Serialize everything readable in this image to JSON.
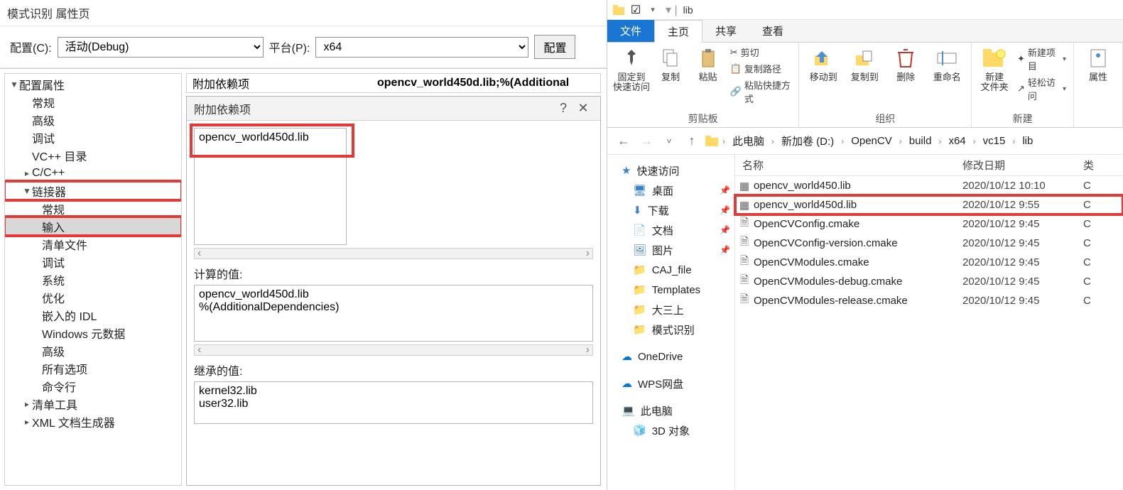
{
  "vs": {
    "title": "模式识别 属性页",
    "config_label": "配置(C):",
    "config_value": "活动(Debug)",
    "platform_label": "平台(P):",
    "platform_value": "x64",
    "mgr_button": "配置",
    "tree": {
      "root": "配置属性",
      "items": [
        "常规",
        "高级",
        "调试",
        "VC++ 目录",
        "C/C++"
      ],
      "linker": "链接器",
      "linker_items": [
        "常规",
        "输入",
        "清单文件",
        "调试",
        "系统",
        "优化",
        "嵌入的 IDL",
        "Windows 元数据",
        "高级",
        "所有选项",
        "命令行"
      ],
      "manifest_tool": "清单工具",
      "xml_gen": "XML 文档生成器"
    },
    "prop_key": "附加依赖项",
    "prop_val": "opencv_world450d.lib;%(Additional",
    "dialog": {
      "title": "附加依赖项",
      "edit_value": "opencv_world450d.lib",
      "calc_label": "计算的值:",
      "calc_value": "opencv_world450d.lib\n%(AdditionalDependencies)",
      "inherit_label": "继承的值:",
      "inherit_value": "kernel32.lib\nuser32.lib"
    }
  },
  "ex": {
    "titlebar": "lib",
    "tabs": {
      "file": "文件",
      "home": "主页",
      "share": "共享",
      "view": "查看"
    },
    "ribbon": {
      "pin": "固定到\n快速访问",
      "copy": "复制",
      "paste": "粘贴",
      "cut": "剪切",
      "copypath": "复制路径",
      "paste_shortcut": "粘贴快捷方式",
      "clipboard": "剪贴板",
      "moveto": "移动到",
      "copyto": "复制到",
      "delete": "删除",
      "rename": "重命名",
      "organize": "组织",
      "newfolder": "新建\n文件夹",
      "newitem": "新建项目",
      "easyaccess": "轻松访问",
      "new": "新建",
      "props": "属性"
    },
    "breadcrumb": [
      "此电脑",
      "新加卷 (D:)",
      "OpenCV",
      "build",
      "x64",
      "vc15",
      "lib"
    ],
    "nav": {
      "quick": "快速访问",
      "desktop": "桌面",
      "downloads": "下载",
      "documents": "文档",
      "pictures": "图片",
      "caj": "CAJ_file",
      "templates": "Templates",
      "da3": "大三上",
      "pattern": "模式识别",
      "onedrive": "OneDrive",
      "wps": "WPS网盘",
      "thispc": "此电脑",
      "obj3d": "3D 对象"
    },
    "columns": {
      "name": "名称",
      "date": "修改日期",
      "type": "类"
    },
    "files": [
      {
        "name": "opencv_world450.lib",
        "date": "2020/10/12 10:10",
        "type": "C",
        "icon": "lib"
      },
      {
        "name": "opencv_world450d.lib",
        "date": "2020/10/12 9:55",
        "type": "C",
        "icon": "lib"
      },
      {
        "name": "OpenCVConfig.cmake",
        "date": "2020/10/12 9:45",
        "type": "C",
        "icon": "file"
      },
      {
        "name": "OpenCVConfig-version.cmake",
        "date": "2020/10/12 9:45",
        "type": "C",
        "icon": "file"
      },
      {
        "name": "OpenCVModules.cmake",
        "date": "2020/10/12 9:45",
        "type": "C",
        "icon": "file"
      },
      {
        "name": "OpenCVModules-debug.cmake",
        "date": "2020/10/12 9:45",
        "type": "C",
        "icon": "file"
      },
      {
        "name": "OpenCVModules-release.cmake",
        "date": "2020/10/12 9:45",
        "type": "C",
        "icon": "file"
      }
    ]
  }
}
